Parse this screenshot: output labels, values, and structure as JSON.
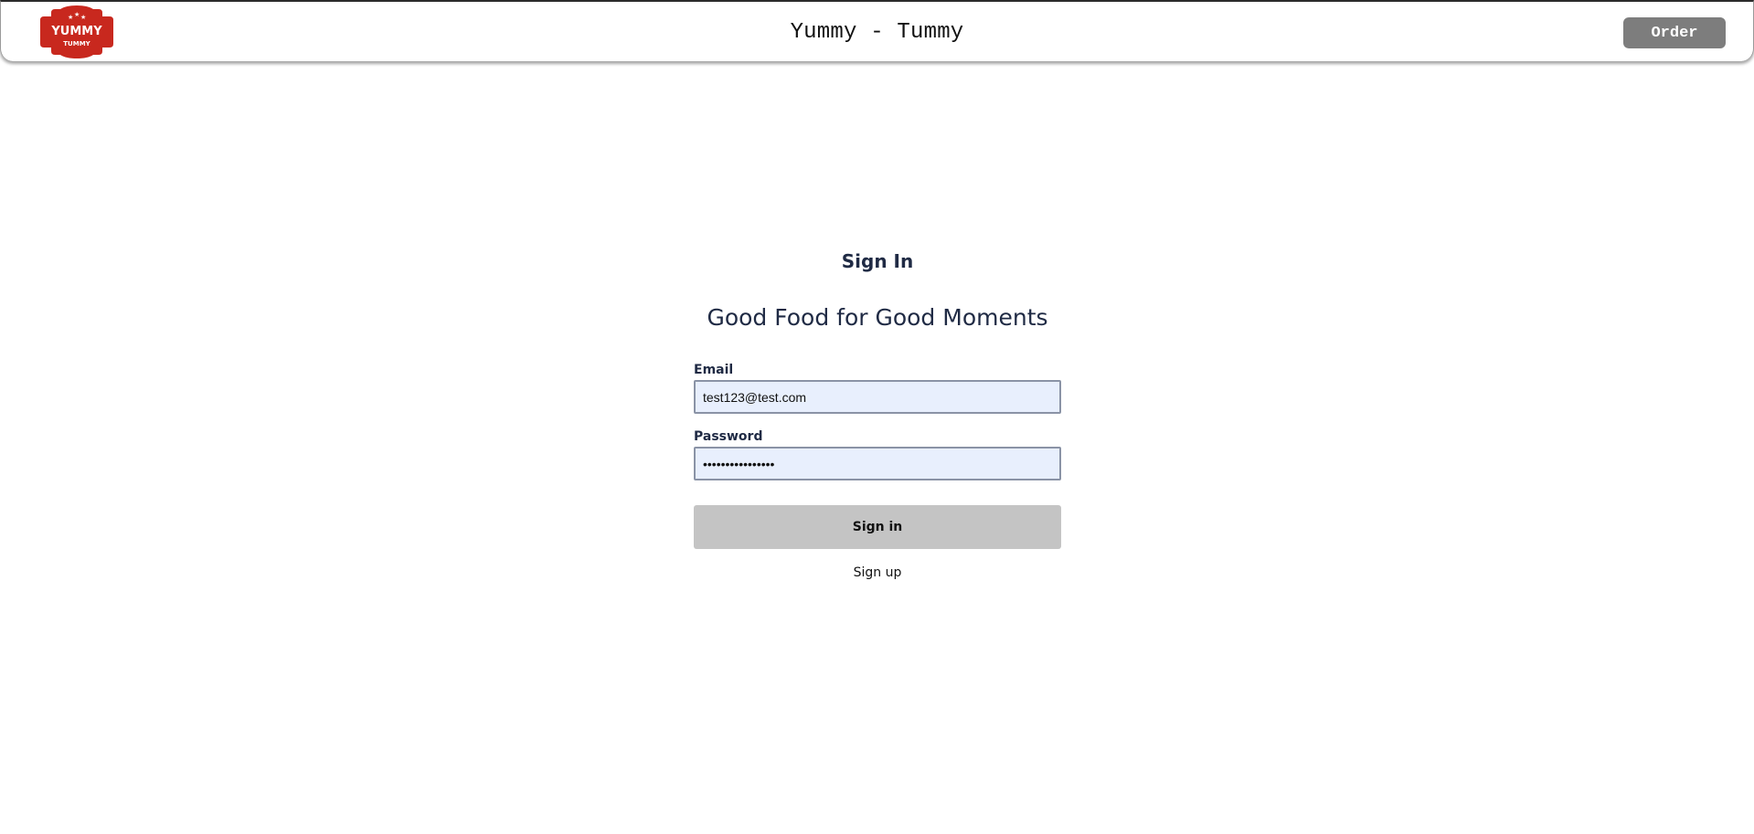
{
  "header": {
    "logo": {
      "top_text": "YUMMY",
      "bottom_text": "TUMMY",
      "color": "#c8281e"
    },
    "title": "Yummy - Tummy",
    "order_label": "Order"
  },
  "signin": {
    "heading": "Sign In",
    "tagline": "Good Food for Good Moments",
    "email": {
      "label": "Email",
      "value": "test123@test.com"
    },
    "password": {
      "label": "Password",
      "value": "••••••••••••••••"
    },
    "submit_label": "Sign in",
    "signup_label": "Sign up"
  },
  "colors": {
    "input_fill": "#e8effd",
    "button_fill": "#c4c4c4",
    "order_button": "#7d7d7d",
    "text": "#1f2a44"
  }
}
